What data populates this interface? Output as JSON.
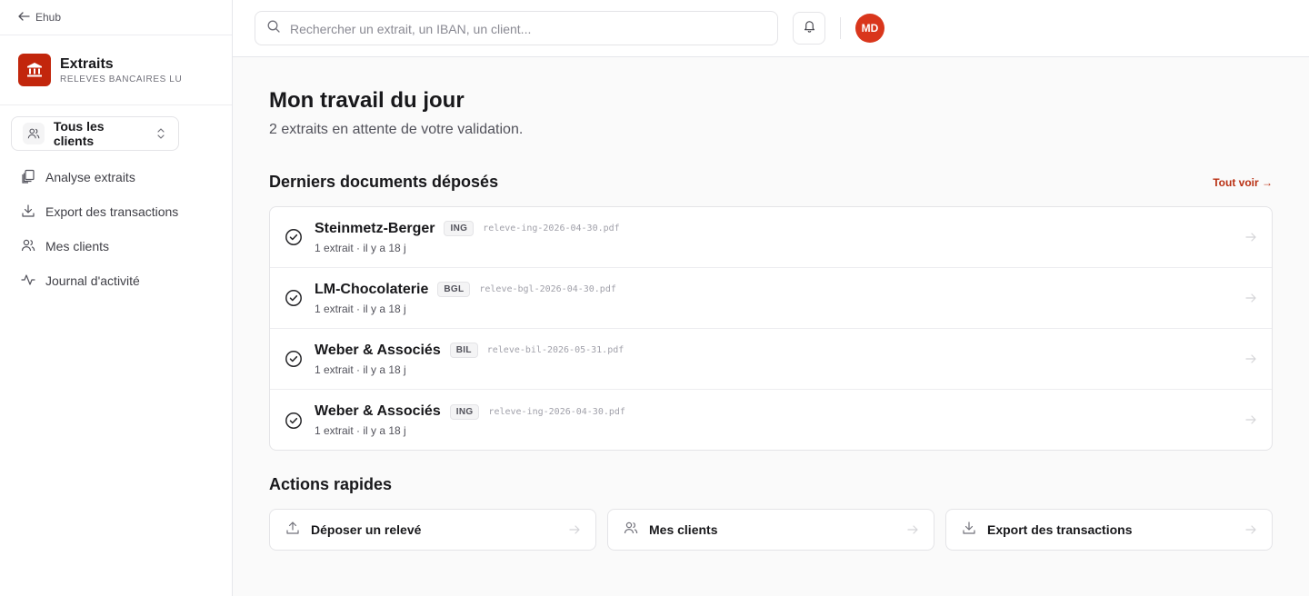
{
  "sidebar": {
    "back_label": "Ehub",
    "brand_title": "Extraits",
    "brand_subtitle": "RELEVES BANCAIRES LU",
    "client_selector": "Tous les clients",
    "nav": [
      {
        "label": "Analyse extraits",
        "icon": "documents-icon"
      },
      {
        "label": "Export des transactions",
        "icon": "download-icon"
      },
      {
        "label": "Mes clients",
        "icon": "users-icon"
      },
      {
        "label": "Journal d'activité",
        "icon": "activity-icon"
      }
    ]
  },
  "topbar": {
    "search_placeholder": "Rechercher un extrait, un IBAN, un client...",
    "avatar_initials": "MD"
  },
  "main": {
    "title": "Mon travail du jour",
    "subtitle": "2 extraits en attente de votre validation.",
    "recent_title": "Derniers documents déposés",
    "see_all": "Tout voir →",
    "documents": [
      {
        "client": "Steinmetz-Berger",
        "bank": "ING",
        "file": "releve-ing-2026-04-30.pdf",
        "meta": "1 extrait · il y a 18 j"
      },
      {
        "client": "LM-Chocolaterie",
        "bank": "BGL",
        "file": "releve-bgl-2026-04-30.pdf",
        "meta": "1 extrait · il y a 18 j"
      },
      {
        "client": "Weber & Associés",
        "bank": "BIL",
        "file": "releve-bil-2026-05-31.pdf",
        "meta": "1 extrait · il y a 18 j"
      },
      {
        "client": "Weber & Associés",
        "bank": "ING",
        "file": "releve-ing-2026-04-30.pdf",
        "meta": "1 extrait · il y a 18 j"
      }
    ],
    "quick_title": "Actions rapides",
    "quick_actions": [
      {
        "label": "Déposer un relevé",
        "icon": "upload-icon"
      },
      {
        "label": "Mes clients",
        "icon": "users-icon"
      },
      {
        "label": "Export des transactions",
        "icon": "download-icon"
      }
    ]
  },
  "colors": {
    "accent": "#b92f12",
    "brand": "#c2260c",
    "avatar": "#d9361c"
  }
}
